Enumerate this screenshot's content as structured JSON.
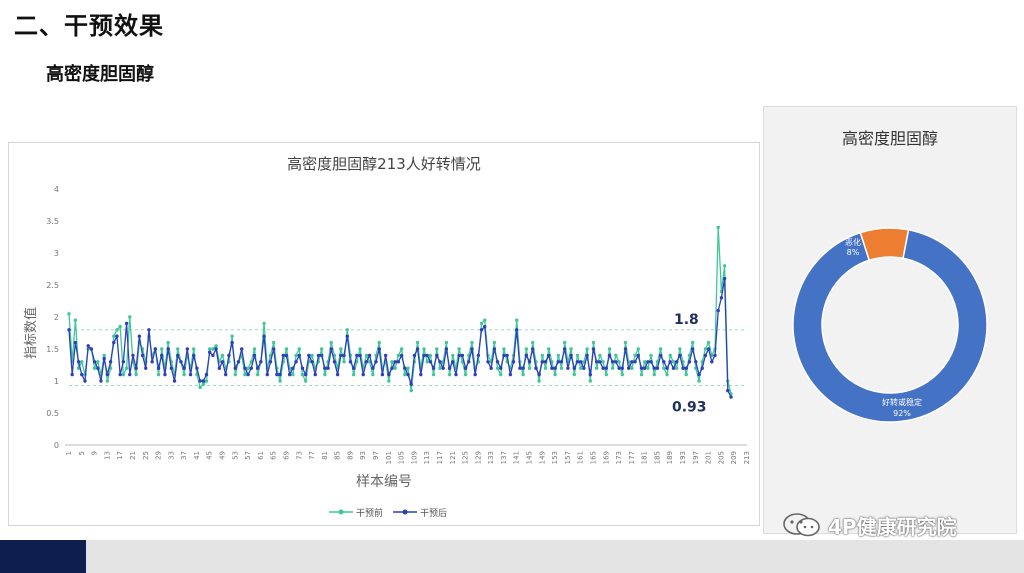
{
  "slide": {
    "title": "二、干预效果",
    "subtitle": "高密度胆固醇"
  },
  "watermark": {
    "text": "4P健康研究院",
    "icon": "wechat-icon"
  },
  "colors": {
    "before": "#3fc79a",
    "after": "#2f3fb8",
    "ref_line": "#9fd9c6",
    "donut_good": "#4472c4",
    "donut_bad": "#ed7d31",
    "footer_accent": "#0e1f4f"
  },
  "chart_data": [
    {
      "type": "line",
      "title": "高密度胆固醇213人好转情况",
      "xlabel": "样本编号",
      "ylabel": "指标数值",
      "ylim": [
        0,
        4
      ],
      "yticks": [
        "0",
        "0.5",
        "1",
        "1.5",
        "2",
        "2.5",
        "3",
        "3.5",
        "4"
      ],
      "xticks": [
        "1",
        "5",
        "9",
        "13",
        "17",
        "21",
        "25",
        "29",
        "33",
        "37",
        "41",
        "45",
        "49",
        "53",
        "57",
        "61",
        "65",
        "69",
        "73",
        "77",
        "81",
        "85",
        "89",
        "93",
        "97",
        "101",
        "105",
        "109",
        "113",
        "117",
        "121",
        "125",
        "129",
        "133",
        "137",
        "141",
        "145",
        "149",
        "153",
        "157",
        "161",
        "165",
        "169",
        "173",
        "177",
        "181",
        "185",
        "189",
        "193",
        "197",
        "201",
        "205",
        "209",
        "213"
      ],
      "x_count": 213,
      "ref_lines": [
        {
          "value": 1.8,
          "label": "1.8"
        },
        {
          "value": 0.93,
          "label": "0.93"
        }
      ],
      "legend_position": "bottom",
      "grid": false,
      "series": [
        {
          "name": "干预前",
          "values": [
            2.05,
            1.3,
            1.95,
            1.2,
            1.3,
            1.1,
            1.5,
            1.5,
            1.2,
            1.3,
            1.1,
            1.4,
            1.0,
            1.2,
            1.7,
            1.8,
            1.85,
            1.1,
            1.2,
            2.0,
            1.3,
            1.1,
            1.6,
            1.5,
            1.3,
            1.7,
            1.4,
            1.5,
            1.1,
            1.5,
            1.2,
            1.6,
            1.3,
            1.1,
            1.5,
            1.3,
            1.1,
            1.4,
            1.2,
            1.5,
            1.1,
            0.9,
            0.95,
            1.0,
            1.5,
            1.5,
            1.55,
            1.3,
            1.4,
            1.2,
            1.3,
            1.7,
            1.1,
            1.3,
            1.4,
            1.1,
            1.2,
            1.3,
            1.5,
            1.1,
            1.3,
            1.9,
            1.2,
            1.4,
            1.6,
            1.2,
            1.0,
            1.3,
            1.5,
            1.2,
            1.1,
            1.4,
            1.5,
            1.1,
            1.0,
            1.3,
            1.4,
            1.2,
            1.3,
            1.5,
            1.1,
            1.3,
            1.6,
            1.4,
            1.2,
            1.5,
            1.3,
            1.8,
            1.4,
            1.1,
            1.3,
            1.5,
            1.2,
            1.4,
            1.3,
            1.1,
            1.4,
            1.6,
            1.2,
            1.3,
            1.0,
            1.3,
            1.2,
            1.4,
            1.5,
            1.1,
            1.2,
            0.85,
            1.3,
            1.6,
            1.2,
            1.5,
            1.3,
            1.4,
            1.1,
            1.5,
            1.2,
            1.3,
            1.6,
            1.1,
            1.4,
            1.2,
            1.5,
            1.3,
            1.1,
            1.4,
            1.6,
            1.2,
            1.3,
            1.9,
            1.95,
            1.4,
            1.3,
            1.6,
            1.2,
            1.1,
            1.5,
            1.3,
            1.2,
            1.4,
            1.95,
            1.3,
            1.1,
            1.5,
            1.2,
            1.6,
            1.3,
            1.0,
            1.4,
            1.2,
            1.5,
            1.3,
            1.1,
            1.4,
            1.2,
            1.6,
            1.3,
            1.5,
            1.1,
            1.4,
            1.2,
            1.3,
            1.5,
            1.0,
            1.6,
            1.2,
            1.4,
            1.3,
            1.1,
            1.5,
            1.2,
            1.4,
            1.3,
            1.1,
            1.6,
            1.3,
            1.2,
            1.4,
            1.5,
            1.1,
            1.3,
            1.2,
            1.4,
            1.1,
            1.3,
            1.5,
            1.2,
            1.1,
            1.4,
            1.3,
            1.2,
            1.5,
            1.3,
            1.1,
            1.4,
            1.6,
            1.2,
            1.0,
            1.3,
            1.5,
            1.6,
            1.4,
            1.5,
            3.4,
            2.4,
            2.8,
            1.0,
            0.8
          ],
          "marker": "circle"
        },
        {
          "name": "干预后",
          "values": [
            1.8,
            1.1,
            1.6,
            1.3,
            1.1,
            1.0,
            1.55,
            1.5,
            1.3,
            1.2,
            1.0,
            1.35,
            1.1,
            1.3,
            1.6,
            1.7,
            1.1,
            1.3,
            1.9,
            1.1,
            1.4,
            1.2,
            1.7,
            1.4,
            1.2,
            1.8,
            1.3,
            1.5,
            1.2,
            1.4,
            1.1,
            1.5,
            1.2,
            1.0,
            1.4,
            1.3,
            1.2,
            1.5,
            1.1,
            1.4,
            1.2,
            1.0,
            1.0,
            1.1,
            1.45,
            1.4,
            1.5,
            1.2,
            1.3,
            1.1,
            1.4,
            1.6,
            1.2,
            1.3,
            1.5,
            1.2,
            1.1,
            1.2,
            1.4,
            1.2,
            1.3,
            1.7,
            1.1,
            1.3,
            1.5,
            1.1,
            1.1,
            1.4,
            1.4,
            1.1,
            1.2,
            1.3,
            1.4,
            1.2,
            1.1,
            1.4,
            1.3,
            1.1,
            1.4,
            1.4,
            1.2,
            1.2,
            1.5,
            1.3,
            1.1,
            1.4,
            1.4,
            1.7,
            1.3,
            1.2,
            1.4,
            1.4,
            1.1,
            1.3,
            1.4,
            1.2,
            1.3,
            1.5,
            1.1,
            1.4,
            1.1,
            1.2,
            1.3,
            1.3,
            1.4,
            1.2,
            1.1,
            0.95,
            1.4,
            1.5,
            1.1,
            1.4,
            1.4,
            1.3,
            1.2,
            1.4,
            1.3,
            1.2,
            1.5,
            1.2,
            1.3,
            1.1,
            1.4,
            1.4,
            1.2,
            1.3,
            1.5,
            1.1,
            1.4,
            1.8,
            1.85,
            1.3,
            1.2,
            1.5,
            1.3,
            1.2,
            1.4,
            1.4,
            1.1,
            1.3,
            1.8,
            1.2,
            1.2,
            1.4,
            1.3,
            1.5,
            1.2,
            1.1,
            1.3,
            1.3,
            1.4,
            1.2,
            1.2,
            1.3,
            1.3,
            1.5,
            1.2,
            1.4,
            1.2,
            1.3,
            1.3,
            1.2,
            1.4,
            1.1,
            1.5,
            1.3,
            1.3,
            1.2,
            1.2,
            1.4,
            1.3,
            1.3,
            1.2,
            1.2,
            1.5,
            1.2,
            1.3,
            1.3,
            1.4,
            1.2,
            1.2,
            1.3,
            1.3,
            1.2,
            1.2,
            1.4,
            1.3,
            1.2,
            1.3,
            1.2,
            1.3,
            1.4,
            1.2,
            1.2,
            1.3,
            1.5,
            1.3,
            1.1,
            1.2,
            1.4,
            1.5,
            1.3,
            1.4,
            2.1,
            2.3,
            2.6,
            0.85,
            0.75
          ],
          "marker": "circle"
        }
      ]
    },
    {
      "type": "pie",
      "title": "高密度胆固醇",
      "donut": true,
      "slices": [
        {
          "label": "好转或稳定",
          "value": 92,
          "value_label": "92%",
          "color": "#4472c4"
        },
        {
          "label": "恶化",
          "value": 8,
          "value_label": "8%",
          "color": "#ed7d31"
        }
      ]
    }
  ]
}
